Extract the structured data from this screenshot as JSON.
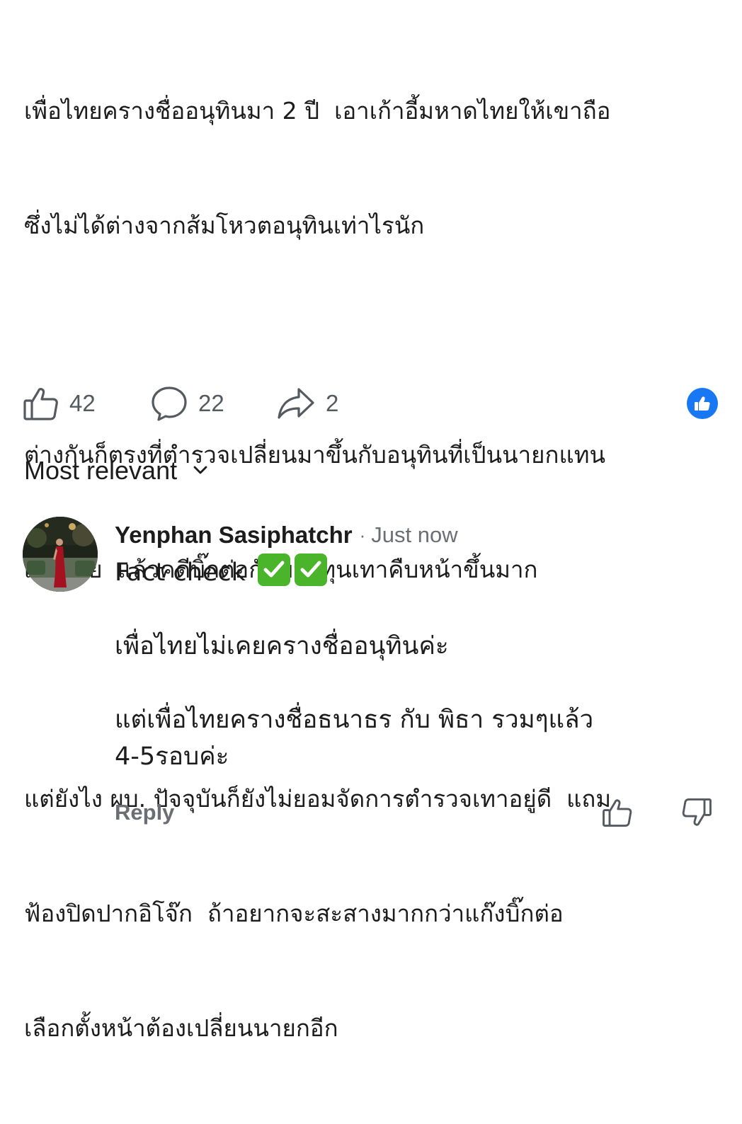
{
  "post": {
    "paragraphs": [
      [
        "เพื่อไทยครางชื่ออนุทินมา 2 ปี  เอาเก้าอี้มหาดไทยให้เขาถือ",
        "ซึ่งไม่ได้ต่างจากส้มโหวตอนุทินเท่าไรนัก"
      ],
      [
        "ต่างกันก็ตรงที่ตำรวจเปลี่ยนมาขึ้นกับอนุทินที่เป็นนายกแทน",
        "เพื่อไทย  แล้วคดีบิ๊กต่อกับพวกทุนเทาคืบหน้าขึ้นมาก"
      ],
      [
        "แต่ยังไง ผบ. ปัจจุบันก็ยังไม่ยอมจัดการตำรวจเทาอยู่ดี  แถม",
        "ฟ้องปิดปากอิโจ๊ก  ถ้าอยากจะสะสางมากกว่าแก๊งบิ๊กต่อ",
        "เลือกตั้งหน้าต้องเปลี่ยนนายกอีก"
      ]
    ]
  },
  "actions": {
    "like_count": "42",
    "comment_count": "22",
    "share_count": "2",
    "like_icon": "thumbs-up-outline-icon",
    "comment_icon": "speech-bubble-icon",
    "share_icon": "share-arrow-icon",
    "reaction_icon": "like-reaction-badge-icon",
    "reaction_color": "#1877f2"
  },
  "sort": {
    "label": "Most relevant",
    "icon": "chevron-down-icon"
  },
  "comment": {
    "author": "Yenphan Sasiphatchr",
    "separator": "·",
    "time": "Just now",
    "paragraphs": [
      [
        "Fact check"
      ],
      [
        "เพื่อไทยไม่เคยครางชื่ออนุทินค่ะ"
      ],
      [
        "แต่เพื่อไทยครางชื่อธนาธร กับ พิธา รวมๆแล้ว",
        "4-5รอบค่ะ"
      ]
    ],
    "emoji": "check-mark-button-icon",
    "emoji_color": "#4ab52a",
    "reply_label": "Reply",
    "upvote_icon": "thumbs-up-outline-icon",
    "downvote_icon": "thumbs-down-outline-icon"
  }
}
